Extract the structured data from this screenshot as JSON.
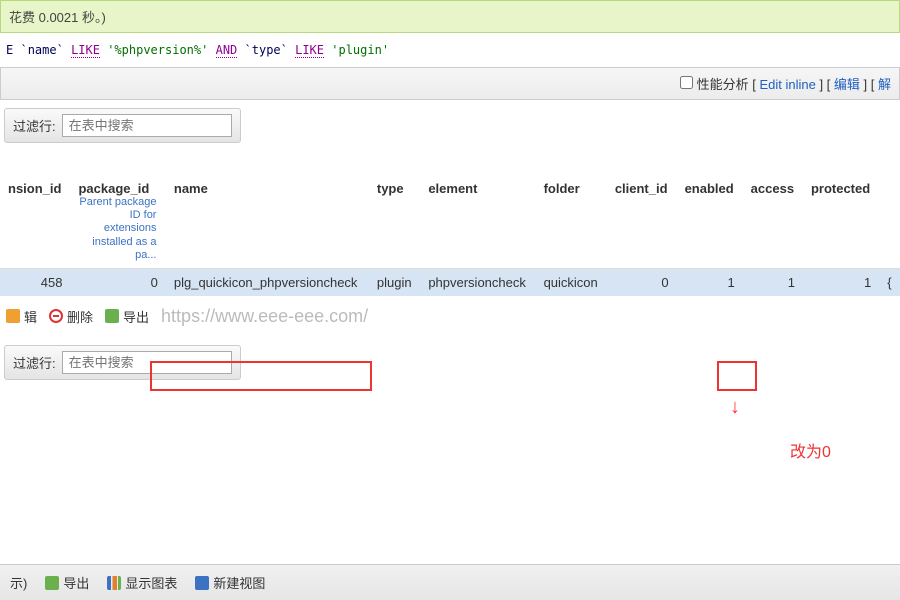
{
  "msg": "花费 0.0021 秒。)",
  "sql": {
    "e": "E",
    "col_name": "`name`",
    "like": "LIKE",
    "pat_name": "'%phpversion%'",
    "and": "AND",
    "col_type": "`type`",
    "pat_type": "'plugin'"
  },
  "tools": {
    "perf": "性能分析",
    "edit_inline": "Edit inline",
    "edit": "编辑",
    "more": "解"
  },
  "filter": {
    "label": "过滤行:",
    "placeholder": "在表中搜索"
  },
  "headers": {
    "ext_id": "nsion_id",
    "pkg_id": "package_id",
    "pkg_sub": "Parent package ID for extensions installed as a pa...",
    "name": "name",
    "type": "type",
    "element": "element",
    "folder": "folder",
    "client_id": "client_id",
    "enabled": "enabled",
    "access": "access",
    "protected": "protected"
  },
  "row": {
    "ext_id": "458",
    "pkg_id": "0",
    "name": "plg_quickicon_phpversioncheck",
    "type": "plugin",
    "element": "phpversioncheck",
    "folder": "quickicon",
    "client_id": "0",
    "enabled": "1",
    "access": "1",
    "protected": "1",
    "tail": "{"
  },
  "actions": {
    "edit": "辑",
    "delete": "删除",
    "export": "导出"
  },
  "watermark": "https://www.eee-eee.com/",
  "annot": "改为0",
  "footer": {
    "show": "示)",
    "export": "导出",
    "chart": "显示图表",
    "newview": "新建视图"
  }
}
